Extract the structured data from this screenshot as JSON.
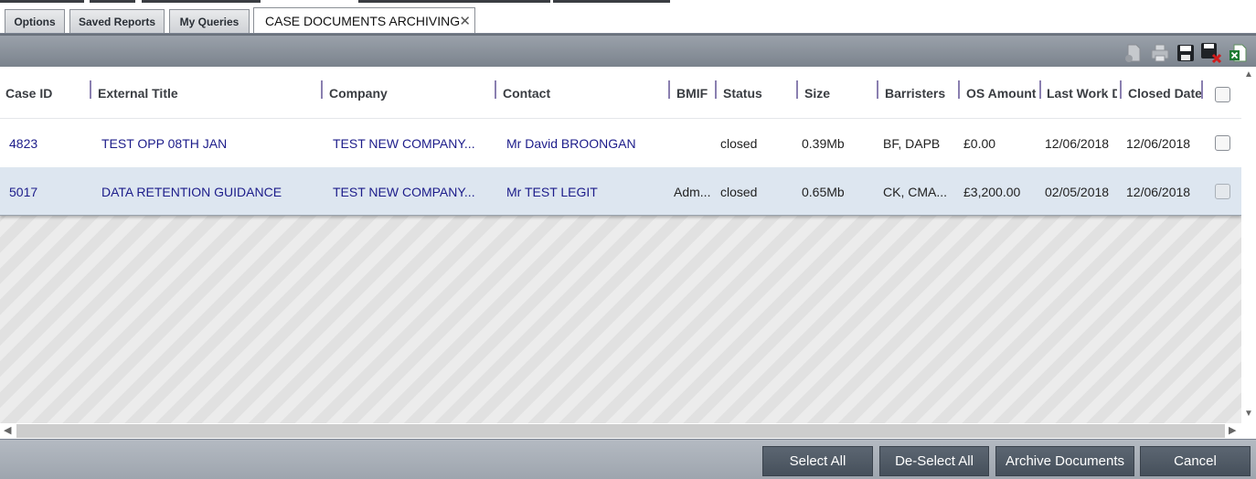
{
  "tabs": [
    {
      "label": "Options"
    },
    {
      "label": "Saved Reports"
    },
    {
      "label": "My Queries"
    },
    {
      "label": "CASE DOCUMENTS ARCHIVING",
      "active": true
    }
  ],
  "tab_close_glyph": "✕",
  "toolbar": {
    "icons": [
      "new-document-icon",
      "print-icon",
      "save-icon",
      "save-and-close-icon",
      "export-excel-icon"
    ]
  },
  "grid": {
    "columns": [
      "Case ID",
      "External Title",
      "Company",
      "Contact",
      "BMIF",
      "Status",
      "Size",
      "Barristers",
      "OS Amount",
      "Last Work D",
      "Closed Date"
    ],
    "rows": [
      {
        "case_id": "4823",
        "external_title": "TEST OPP 08TH JAN",
        "company": "TEST NEW COMPANY...",
        "contact": "Mr David BROONGAN",
        "bmif": "",
        "status": "closed",
        "size": "0.39Mb",
        "barristers": "BF, DAPB",
        "os_amount": "£0.00",
        "last_work": "12/06/2018",
        "closed_date": "12/06/2018"
      },
      {
        "case_id": "5017",
        "external_title": "DATA RETENTION GUIDANCE",
        "company": "TEST NEW COMPANY...",
        "contact": "Mr TEST LEGIT",
        "bmif": "Adm...",
        "status": "closed",
        "size": "0.65Mb",
        "barristers": "CK, CMA...",
        "os_amount": "£3,200.00",
        "last_work": "02/05/2018",
        "closed_date": "12/06/2018"
      }
    ]
  },
  "footer": {
    "select_all": "Select All",
    "deselect_all": "De-Select All",
    "archive": "Archive Documents",
    "cancel": "Cancel"
  },
  "colors": {
    "link": "#1c1c8a",
    "button": "#4f5965",
    "row_selected": "#dde6f0"
  }
}
